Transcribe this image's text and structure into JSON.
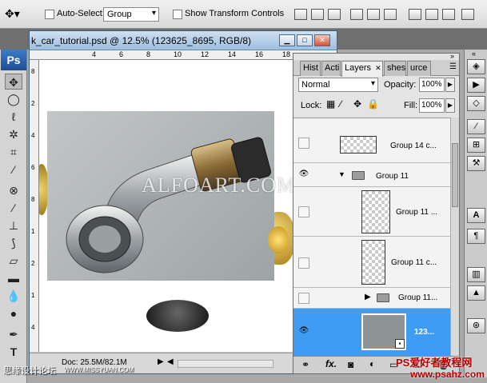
{
  "options_bar": {
    "auto_select_label": "Auto-Select:",
    "auto_select_value": "Group",
    "show_transform_label": "Show Transform Controls"
  },
  "app": {
    "logo": "Ps"
  },
  "document": {
    "title": "k_car_tutorial.psd @ 12.5% (123625_8695, RGB/8)",
    "ruler_h_ticks": [
      "4",
      "6",
      "8",
      "10",
      "12",
      "14",
      "16",
      "18"
    ],
    "ruler_v_ticks": [
      "8",
      "2",
      "4",
      "6",
      "8",
      "1",
      "2",
      "1",
      "4"
    ],
    "status_text": "Doc: 25.5M/82.1M",
    "watermark": "ALFOART.COM"
  },
  "layers_panel": {
    "tabs": [
      "Hist",
      "Acti",
      "Layers",
      "shes",
      "urce"
    ],
    "blend_mode": "Normal",
    "opacity_label": "Opacity:",
    "opacity_value": "100%",
    "lock_label": "Lock:",
    "fill_label": "Fill:",
    "fill_value": "100%",
    "layers": [
      {
        "name": "Group 14 c...",
        "visible": false
      },
      {
        "name": "Group 11",
        "visible": true,
        "type": "group"
      },
      {
        "name": "Group 11 ...",
        "visible": false
      },
      {
        "name": "Group 11 c...",
        "visible": false
      },
      {
        "name": "Group 11...",
        "visible": false,
        "type": "group"
      },
      {
        "name": "123...",
        "visible": true,
        "selected": true
      }
    ],
    "bottom_icons": [
      "link-icon",
      "fx-icon",
      "mask-icon",
      "adjustment-icon",
      "folder-icon",
      "new-layer-icon",
      "trash-icon"
    ]
  },
  "footer": {
    "left_text": "思缘设计论坛",
    "left_url": "WWW.MISSYUAN.COM",
    "right_text": "PS爱好者教程网",
    "right_url": "www.psahz.com"
  },
  "colors": {
    "selected_layer": "#3f9cf3",
    "panel_bg": "#e4e4e4",
    "title_bar": "#9ebfdf"
  }
}
